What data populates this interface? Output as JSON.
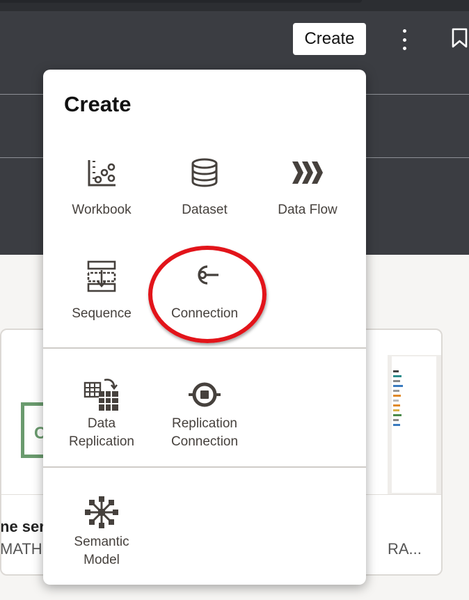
{
  "header": {
    "create_button": "Create"
  },
  "background_card": {
    "thumb_letter": "C",
    "title_fragment": "ne ser",
    "subtitle_left": "MATHE",
    "subtitle_right": "RA..."
  },
  "menu": {
    "title": "Create",
    "sections": [
      {
        "items": [
          {
            "label": "Workbook",
            "icon": "workbook-icon"
          },
          {
            "label": "Dataset",
            "icon": "dataset-icon"
          },
          {
            "label": "Data Flow",
            "icon": "data-flow-icon"
          },
          {
            "label": "Sequence",
            "icon": "sequence-icon"
          },
          {
            "label": "Connection",
            "icon": "connection-icon"
          }
        ]
      },
      {
        "items": [
          {
            "label_line1": "Data",
            "label_line2": "Replication",
            "icon": "data-replication-icon"
          },
          {
            "label_line1": "Replication",
            "label_line2": "Connection",
            "icon": "replication-connection-icon"
          }
        ]
      },
      {
        "items": [
          {
            "label_line1": "Semantic",
            "label_line2": "Model",
            "icon": "semantic-model-icon"
          }
        ]
      }
    ]
  },
  "annotation": {
    "highlight_color": "#e2141a"
  },
  "colors": {
    "header_bg": "#3b3d42",
    "icon": "#46413d",
    "accent_green": "#6a9b6e"
  }
}
